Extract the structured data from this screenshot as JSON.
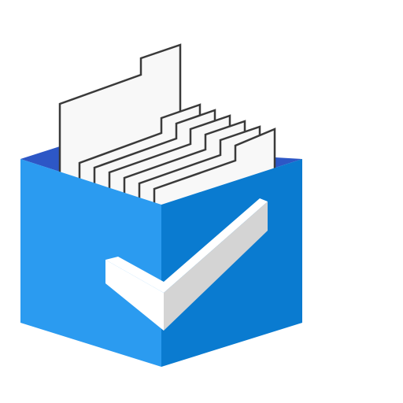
{
  "icon": {
    "name": "file-box-checkmark-icon",
    "colors": {
      "background": "#ffffff",
      "box_left": "#2b9bf0",
      "box_right": "#0a7bd0",
      "box_inner": "#2d57c6",
      "paper_fill": "#f8f8f8",
      "paper_stroke": "#3a3a3a",
      "check_front": "#ffffff",
      "check_side": "#d4d4d4"
    }
  }
}
